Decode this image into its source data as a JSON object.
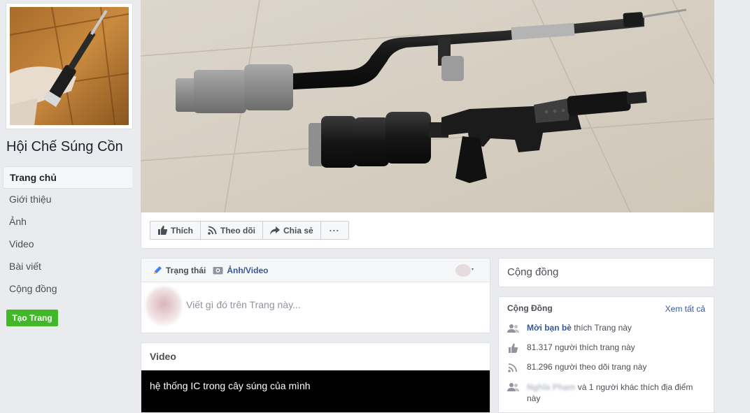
{
  "page": {
    "name": "Hội Chế Súng Cồn"
  },
  "nav": {
    "items": [
      {
        "label": "Trang chủ",
        "active": true
      },
      {
        "label": "Giới thiệu"
      },
      {
        "label": "Ảnh"
      },
      {
        "label": "Video"
      },
      {
        "label": "Bài viết"
      },
      {
        "label": "Cộng đồng"
      }
    ],
    "create_page": "Tạo Trang"
  },
  "actions": {
    "like": "Thích",
    "follow": "Theo dõi",
    "share": "Chia sẻ",
    "more": "···"
  },
  "composer": {
    "tab_status": "Trạng thái",
    "tab_photo": "Ảnh/Video",
    "placeholder": "Viết gì đó trên Trang này..."
  },
  "video": {
    "heading": "Video",
    "title": "hệ thống IC trong cây súng của mình"
  },
  "community": {
    "section_title": "Cộng đồng",
    "card_title": "Cộng Đồng",
    "see_all": "Xem tất cả",
    "invite_link": "Mời bạn bè",
    "invite_rest": " thích Trang này",
    "likes": "81.317 người thích trang này",
    "follows": "81.296 người theo dõi trang này",
    "friend_name_blurred": "Nghĩa Phạm",
    "friend_rest_1": " và 1 người khác thích địa điểm",
    "friend_rest_2": "này"
  },
  "colors": {
    "background": "#e9ebee",
    "link": "#365899",
    "create_button": "#42b72a"
  }
}
